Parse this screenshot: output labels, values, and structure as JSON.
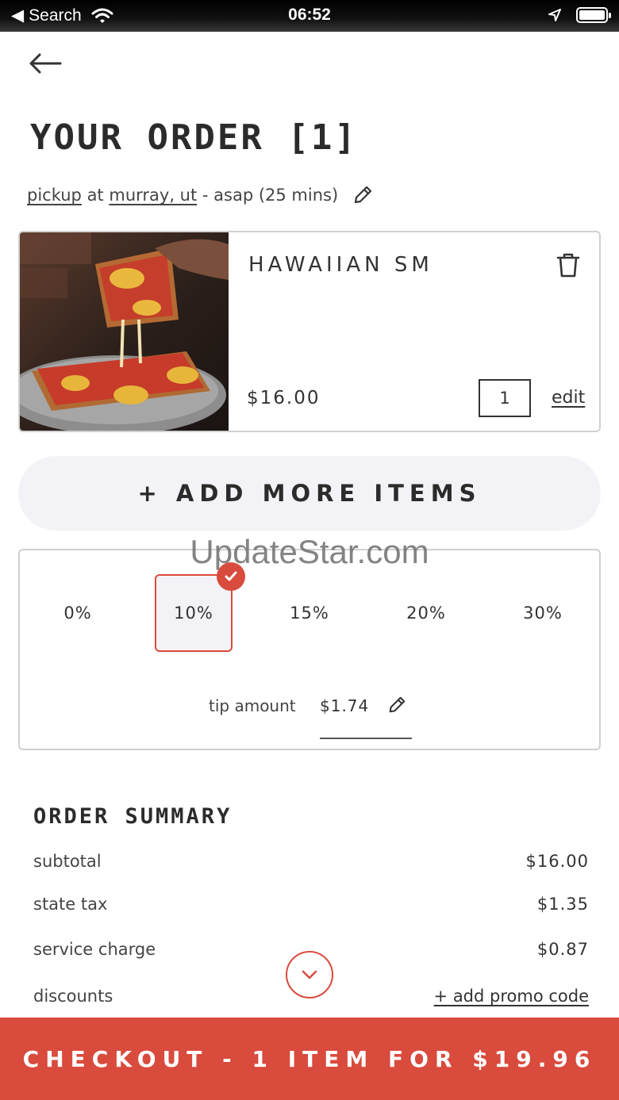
{
  "status_bar": {
    "back_app": "Search",
    "time": "06:52"
  },
  "header": {
    "title": "YOUR ORDER [1]"
  },
  "pickup": {
    "mode": "pickup",
    "at": "at",
    "location": "murray, ut",
    "timing": "- asap (25 mins)"
  },
  "item": {
    "name": "HAWAIIAN SM",
    "price": "$16.00",
    "quantity": "1",
    "edit_label": "edit"
  },
  "add_more": {
    "label": "+ ADD MORE ITEMS"
  },
  "watermark": "UpdateStar.com",
  "tip": {
    "options": [
      "0%",
      "10%",
      "15%",
      "20%",
      "30%"
    ],
    "selected": "10%",
    "amount_label": "tip amount",
    "amount_value": "$1.74"
  },
  "summary": {
    "title": "ORDER SUMMARY",
    "rows": [
      {
        "label": "subtotal",
        "value": "$16.00"
      },
      {
        "label": "state tax",
        "value": "$1.35"
      },
      {
        "label": "service charge",
        "value": "$0.87"
      },
      {
        "label": "discounts",
        "value": "+ add promo code"
      }
    ]
  },
  "checkout": {
    "label": "CHECKOUT - 1 ITEM FOR $19.96"
  },
  "colors": {
    "accent": "#d94b3d",
    "pill_bg": "#f3f3f7",
    "text": "#333333"
  },
  "icons": [
    "back-arrow-icon",
    "wifi-icon",
    "location-arrow-icon",
    "battery-icon",
    "pencil-icon",
    "trash-icon",
    "check-icon",
    "chevron-down-icon"
  ]
}
